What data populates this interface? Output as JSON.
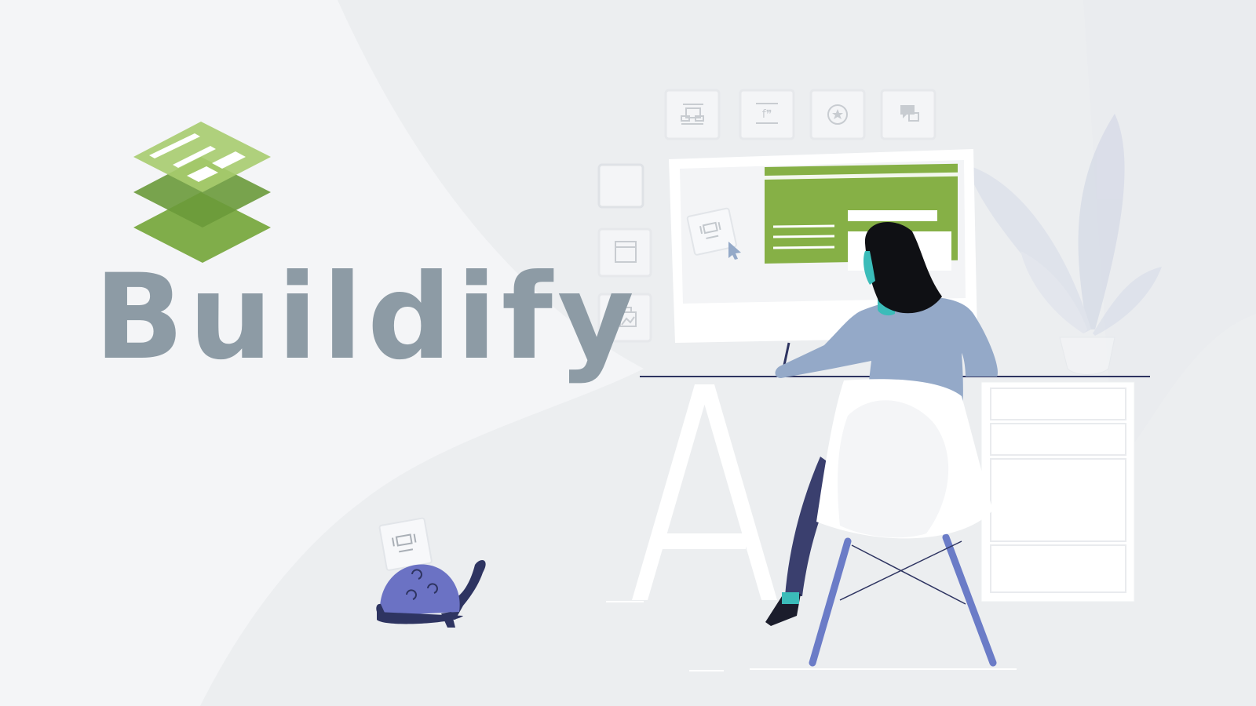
{
  "brand": {
    "name": "Buildify",
    "logo_icon": "stacked-layers-logo",
    "colors": {
      "logo_light": "#a7cc6e",
      "logo_mid": "#80ad4a",
      "logo_dark": "#6a9a3a",
      "title": "#8d9ba5",
      "screen_green": "#86b046",
      "shirt": "#94a9c8",
      "turtle_shell": "#6b72c4",
      "chair_legs": "#6b7cc7"
    }
  },
  "widget_palette": {
    "top_icons": [
      "layout-icon",
      "testimonial-icon",
      "star-rating-icon",
      "like-comment-icon"
    ],
    "side_icons": [
      "blank-widget-icon",
      "window-icon",
      "gallery-icon"
    ],
    "dragged_icon": "slider-widget-icon",
    "turtle_card_icon": "slider-widget-icon"
  }
}
